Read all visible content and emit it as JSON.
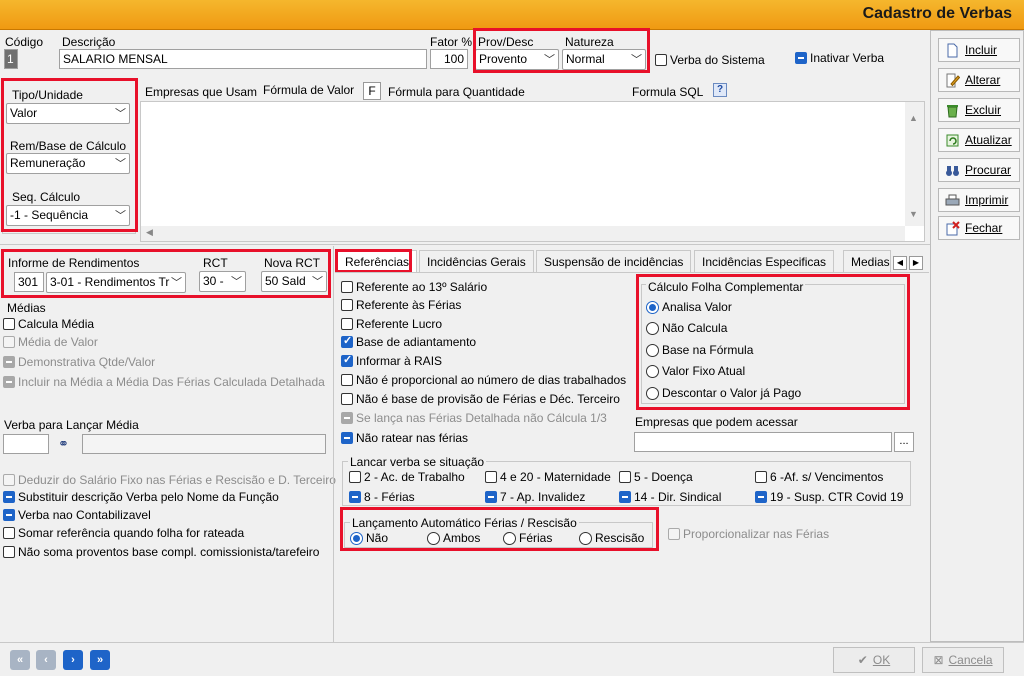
{
  "window": {
    "title": "Cadastro de Verbas"
  },
  "header": {
    "codigo_label": "Código",
    "codigo_value": "1",
    "descricao_label": "Descrição",
    "descricao_value": "SALARIO MENSAL",
    "fator_label": "Fator %",
    "fator_value": "100",
    "prov_label": "Prov/Desc",
    "prov_value": "Provento",
    "natureza_label": "Natureza",
    "natureza_value": "Normal",
    "verba_sistema_label": "Verba do Sistema",
    "inativar_label": "Inativar Verba"
  },
  "left_panel": {
    "tipo_label": "Tipo/Unidade",
    "tipo_value": "Valor",
    "rem_label": "Rem/Base de Cálculo",
    "rem_value": "Remuneração",
    "seq_label": "Seq. Cálculo",
    "seq_value": "-1 - Sequência"
  },
  "formula_tabs": {
    "empresas": "Empresas que Usam",
    "formula_valor": "Fórmula de Valor",
    "f_button": "F",
    "formula_qtd": "Fórmula para Quantidade",
    "formula_sql": "Formula SQL",
    "help": "?"
  },
  "rendimentos": {
    "label": "Informe de Rendimentos",
    "code": "301",
    "value": "3-01 - Rendimentos Tr",
    "rct_label": "RCT",
    "rct_value": "30 -",
    "nova_rct_label": "Nova RCT",
    "nova_rct_value": "50 Sald"
  },
  "medias": {
    "title": "Médias",
    "items": [
      {
        "label": "Calcula Média",
        "state": "off"
      },
      {
        "label": "Média de Valor",
        "state": "dis"
      },
      {
        "label": "Demonstrativa Qtde/Valor",
        "state": "dind"
      },
      {
        "label": "Incluir na Média a Média Das Férias Calculada Detalhada",
        "state": "dind"
      }
    ],
    "verba_lancar_label": "Verba para Lançar Média"
  },
  "bottom_left": {
    "items": [
      {
        "label": "Deduzir do Salário Fixo nas  Férias e Rescisão e D. Terceiro",
        "state": "dis"
      },
      {
        "label": "Substituir descrição Verba pelo Nome da Função",
        "state": "ind"
      },
      {
        "label": "Verba nao Contabilizavel",
        "state": "ind"
      },
      {
        "label": "Somar referência quando folha for rateada",
        "state": "off"
      },
      {
        "label": "Não soma proventos base compl. comissionista/tarefeiro",
        "state": "off"
      }
    ]
  },
  "main_tabs": {
    "items": [
      "Referências",
      "Incidências Gerais",
      "Suspensão de incidências",
      "Incidências Especificas",
      "Medias"
    ]
  },
  "referencias": {
    "items": [
      {
        "label": "Referente ao 13º Salário",
        "state": "off"
      },
      {
        "label": "Referente às Férias",
        "state": "off"
      },
      {
        "label": "Referente Lucro",
        "state": "off"
      },
      {
        "label": "Base de adiantamento",
        "state": "on"
      },
      {
        "label": "Informar à RAIS",
        "state": "on"
      },
      {
        "label": "Não é proporcional ao número de dias trabalhados",
        "state": "off"
      },
      {
        "label": "Não é base de provisão de Férias e Déc. Terceiro",
        "state": "off"
      },
      {
        "label": "Se lança nas Férias Detalhada não Cálcula 1/3",
        "state": "dind"
      },
      {
        "label": "Não ratear nas férias",
        "state": "ind"
      }
    ]
  },
  "calculo_folha": {
    "title": "Cálculo Folha Complementar",
    "options": [
      "Analisa Valor",
      "Não Calcula",
      "Base na Fórmula",
      "Valor Fixo Atual",
      "Descontar o Valor já Pago"
    ],
    "selected": "Analisa Valor"
  },
  "empresas_acessar": {
    "label": "Empresas que podem acessar",
    "button": "..."
  },
  "situacao": {
    "title": "Lancar verba se situação",
    "items": [
      {
        "label": "2 - Ac. de Trabalho",
        "state": "off"
      },
      {
        "label": "4 e 20 - Maternidade",
        "state": "off"
      },
      {
        "label": "5 - Doença",
        "state": "off"
      },
      {
        "label": "6 -Af. s/ Vencimentos",
        "state": "off"
      },
      {
        "label": "8 - Férias",
        "state": "ind"
      },
      {
        "label": "7 - Ap. Invalidez",
        "state": "ind"
      },
      {
        "label": "14  - Dir. Sindical",
        "state": "ind"
      },
      {
        "label": "19 - Susp. CTR Covid 19",
        "state": "ind"
      }
    ]
  },
  "lancamento": {
    "title": "Lançamento Automático Férias / Rescisão",
    "options": [
      "Não",
      "Ambos",
      "Férias",
      "Rescisão"
    ],
    "selected": "Não",
    "proporcionalizar_label": "Proporcionalizar nas Férias"
  },
  "actions": {
    "incluir": "Incluir",
    "alterar": "Alterar",
    "excluir": "Excluir",
    "atualizar": "Atualizar",
    "procurar": "Procurar",
    "imprimir": "Imprimir",
    "fechar": "Fechar"
  },
  "footer": {
    "ok": "OK",
    "cancela": "Cancela"
  }
}
